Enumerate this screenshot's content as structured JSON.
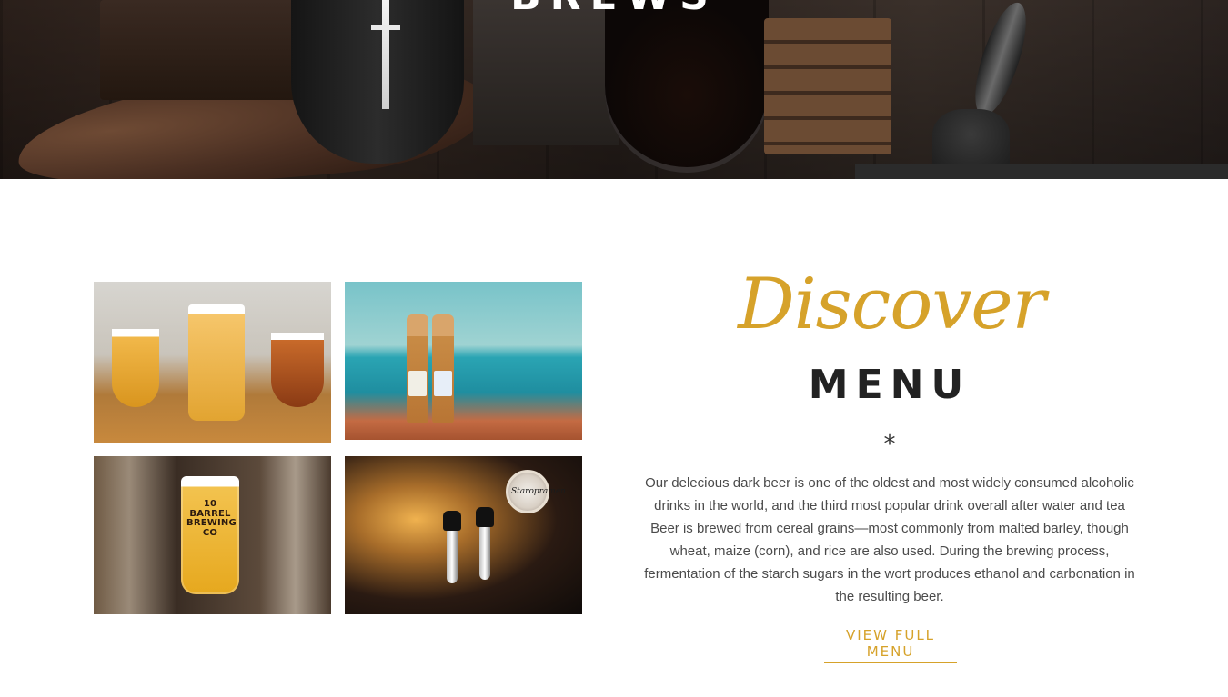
{
  "hero": {
    "title": "BREWS"
  },
  "gallery": {
    "tiles": [
      {
        "alt": "Three glasses of beer on a wooden table"
      },
      {
        "alt": "Two beer bottles on a table by the sea"
      },
      {
        "alt": "Glass of beer with branded logo",
        "logo_text": "10 BARREL BREWING CO"
      },
      {
        "alt": "Beer taps at a bar",
        "badge_text": "Staropramen"
      }
    ]
  },
  "section": {
    "script_title": "Discover",
    "title": "MENU",
    "divider": "*",
    "description": "Our delecious dark beer is one of the oldest and most widely consumed alcoholic drinks in the world, and the third most popular drink overall after water and tea Beer is brewed from cereal grains—most commonly from malted barley, though wheat, maize (corn), and rice are also used. During the brewing process, fermentation of the starch sugars in the wort produces ethanol and carbonation in the resulting beer.",
    "cta_label": "VIEW FULL MENU"
  },
  "colors": {
    "accent": "#d6a22a",
    "heading": "#222222",
    "body": "#4b4b4b"
  }
}
